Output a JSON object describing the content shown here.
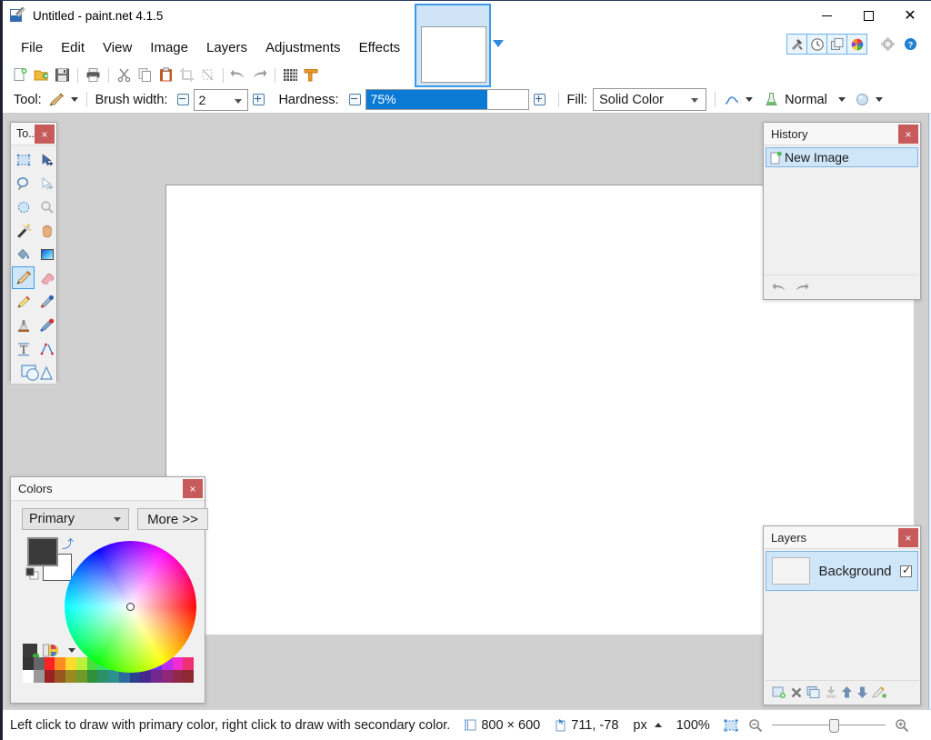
{
  "window": {
    "title": "Untitled - paint.net 4.1.5",
    "app_icon": "paintnet-logo-icon",
    "controls": {
      "minimize": "minimize-icon",
      "maximize": "maximize-icon",
      "close": "close-icon"
    }
  },
  "menubar": {
    "items": [
      {
        "label": "File"
      },
      {
        "label": "Edit"
      },
      {
        "label": "View"
      },
      {
        "label": "Image"
      },
      {
        "label": "Layers"
      },
      {
        "label": "Adjustments"
      },
      {
        "label": "Effects"
      }
    ]
  },
  "panel_toggles": [
    {
      "name": "tools-toggle",
      "icon": "hammer-wrench-icon",
      "active": true
    },
    {
      "name": "history-toggle",
      "icon": "clock-icon",
      "active": true
    },
    {
      "name": "layers-toggle",
      "icon": "layers-icon",
      "active": true
    },
    {
      "name": "colors-toggle",
      "icon": "color-wheel-icon",
      "active": true
    },
    {
      "name": "settings-button",
      "icon": "gear-icon",
      "active": false
    },
    {
      "name": "help-button",
      "icon": "help-icon",
      "active": false
    }
  ],
  "toolbar": {
    "buttons": [
      {
        "name": "new-image",
        "icon": "new-file-icon"
      },
      {
        "name": "open-image",
        "icon": "open-folder-icon"
      },
      {
        "name": "save-image",
        "icon": "save-disk-icon"
      },
      {
        "name": "print-image",
        "icon": "printer-icon"
      },
      {
        "name": "cut",
        "icon": "scissors-icon"
      },
      {
        "name": "copy",
        "icon": "copy-icon"
      },
      {
        "name": "paste",
        "icon": "clipboard-paste-icon"
      },
      {
        "name": "crop-to-selection",
        "icon": "crop-icon"
      },
      {
        "name": "deselect-all",
        "icon": "deselect-icon"
      },
      {
        "name": "undo",
        "icon": "undo-arrow-icon"
      },
      {
        "name": "redo",
        "icon": "redo-arrow-icon"
      },
      {
        "name": "pixel-grid",
        "icon": "grid-icon"
      },
      {
        "name": "rulers",
        "icon": "ruler-icon"
      }
    ]
  },
  "tool_options": {
    "tool_label": "Tool:",
    "tool_icon": "paintbrush-icon",
    "brush_width_label": "Brush width:",
    "brush_width_value": "2",
    "hardness_label": "Hardness:",
    "hardness_value": "75%",
    "hardness_percent": 75,
    "fill_label": "Fill:",
    "fill_value": "Solid Color",
    "antialiasing_icon": "antialiasing-curve-icon",
    "blend_icon": "blend-flask-icon",
    "blend_value": "Normal",
    "alpha_icon": "alpha-sphere-icon"
  },
  "tools_panel": {
    "title": "To...",
    "close": "×",
    "tools": [
      {
        "name": "rectangle-select",
        "icon": "rectangle-select-icon",
        "selected": false
      },
      {
        "name": "move-selected",
        "icon": "move-selected-icon",
        "selected": false
      },
      {
        "name": "lasso-select",
        "icon": "lasso-select-icon",
        "selected": false
      },
      {
        "name": "move-selection",
        "icon": "move-selection-icon",
        "selected": false
      },
      {
        "name": "ellipse-select",
        "icon": "ellipse-select-icon",
        "selected": false
      },
      {
        "name": "zoom-tool",
        "icon": "magnifier-icon",
        "selected": false
      },
      {
        "name": "magic-wand",
        "icon": "magic-wand-icon",
        "selected": false
      },
      {
        "name": "pan",
        "icon": "hand-icon",
        "selected": false
      },
      {
        "name": "paint-bucket",
        "icon": "paint-bucket-icon",
        "selected": false
      },
      {
        "name": "gradient",
        "icon": "gradient-icon",
        "selected": false
      },
      {
        "name": "paintbrush",
        "icon": "paintbrush-icon",
        "selected": true
      },
      {
        "name": "eraser",
        "icon": "eraser-icon",
        "selected": false
      },
      {
        "name": "pencil",
        "icon": "pencil-icon",
        "selected": false
      },
      {
        "name": "color-picker",
        "icon": "eyedropper-icon",
        "selected": false
      },
      {
        "name": "clone-stamp",
        "icon": "clone-stamp-icon",
        "selected": false
      },
      {
        "name": "recolor",
        "icon": "recolor-icon",
        "selected": false
      },
      {
        "name": "text",
        "icon": "text-icon",
        "selected": false
      },
      {
        "name": "line-curve",
        "icon": "line-curve-icon",
        "selected": false
      },
      {
        "name": "shapes",
        "icon": "shapes-icon",
        "selected": false
      }
    ]
  },
  "history_panel": {
    "title": "History",
    "close": "×",
    "items": [
      {
        "label": "New Image",
        "icon": "new-image-icon",
        "selected": true
      }
    ],
    "footer": [
      {
        "name": "history-undo",
        "icon": "undo-arrow-icon"
      },
      {
        "name": "history-redo",
        "icon": "redo-arrow-icon"
      }
    ]
  },
  "layers_panel": {
    "title": "Layers",
    "close": "×",
    "layers": [
      {
        "name": "Background",
        "visible": true,
        "selected": true
      }
    ],
    "footer": [
      {
        "name": "add-layer",
        "icon": "add-layer-icon"
      },
      {
        "name": "delete-layer",
        "icon": "delete-layer-icon"
      },
      {
        "name": "duplicate-layer",
        "icon": "duplicate-layer-icon"
      },
      {
        "name": "merge-layer-down",
        "icon": "merge-down-icon"
      },
      {
        "name": "move-layer-up",
        "icon": "arrow-up-icon"
      },
      {
        "name": "move-layer-down",
        "icon": "arrow-down-icon"
      },
      {
        "name": "layer-properties",
        "icon": "layer-properties-icon"
      }
    ]
  },
  "colors_panel": {
    "title": "Colors",
    "close": "×",
    "selector_value": "Primary",
    "more_label": "More >>",
    "primary_color": "#3a3a3a",
    "secondary_color": "#ffffff",
    "swap_icon": "swap-colors-icon",
    "reset_icon": "reset-colors-icon",
    "add_color_icon": "add-palette-color-icon",
    "palette_icon": "palette-icon",
    "palette_row1": [
      "#333333",
      "#666666",
      "#ff2222",
      "#ff8b23",
      "#ffd92b",
      "#bdf03a",
      "#4adf3e",
      "#37e06e",
      "#32e8a7",
      "#2ef0e6",
      "#2e9bf0",
      "#2e4df0",
      "#6b2ef0",
      "#b92ef0",
      "#f02ed0",
      "#f02e72"
    ],
    "palette_row2": [
      "#ffffff",
      "#9a9a9a",
      "#992222",
      "#99571f",
      "#998a22",
      "#6f9a2a",
      "#2f8f3a",
      "#2c8f66",
      "#2b8f8a",
      "#2b6a9a",
      "#2b3f8f",
      "#46288f",
      "#72288f",
      "#8f2876",
      "#8f2849",
      "#8f2833"
    ]
  },
  "canvas": {
    "background": "#ffffff"
  },
  "statusbar": {
    "hint": "Left click to draw with primary color, right click to draw with secondary color.",
    "image_size_icon": "image-size-icon",
    "image_size": "800 × 600",
    "cursor_pos_icon": "cursor-position-icon",
    "cursor_pos": "711, -78",
    "units": "px",
    "units_arrow": "chevron-up-icon",
    "zoom_value": "100%",
    "fit_icon": "fit-to-window-icon",
    "zoom_out_icon": "zoom-out-icon",
    "zoom_in_icon": "zoom-in-icon"
  }
}
